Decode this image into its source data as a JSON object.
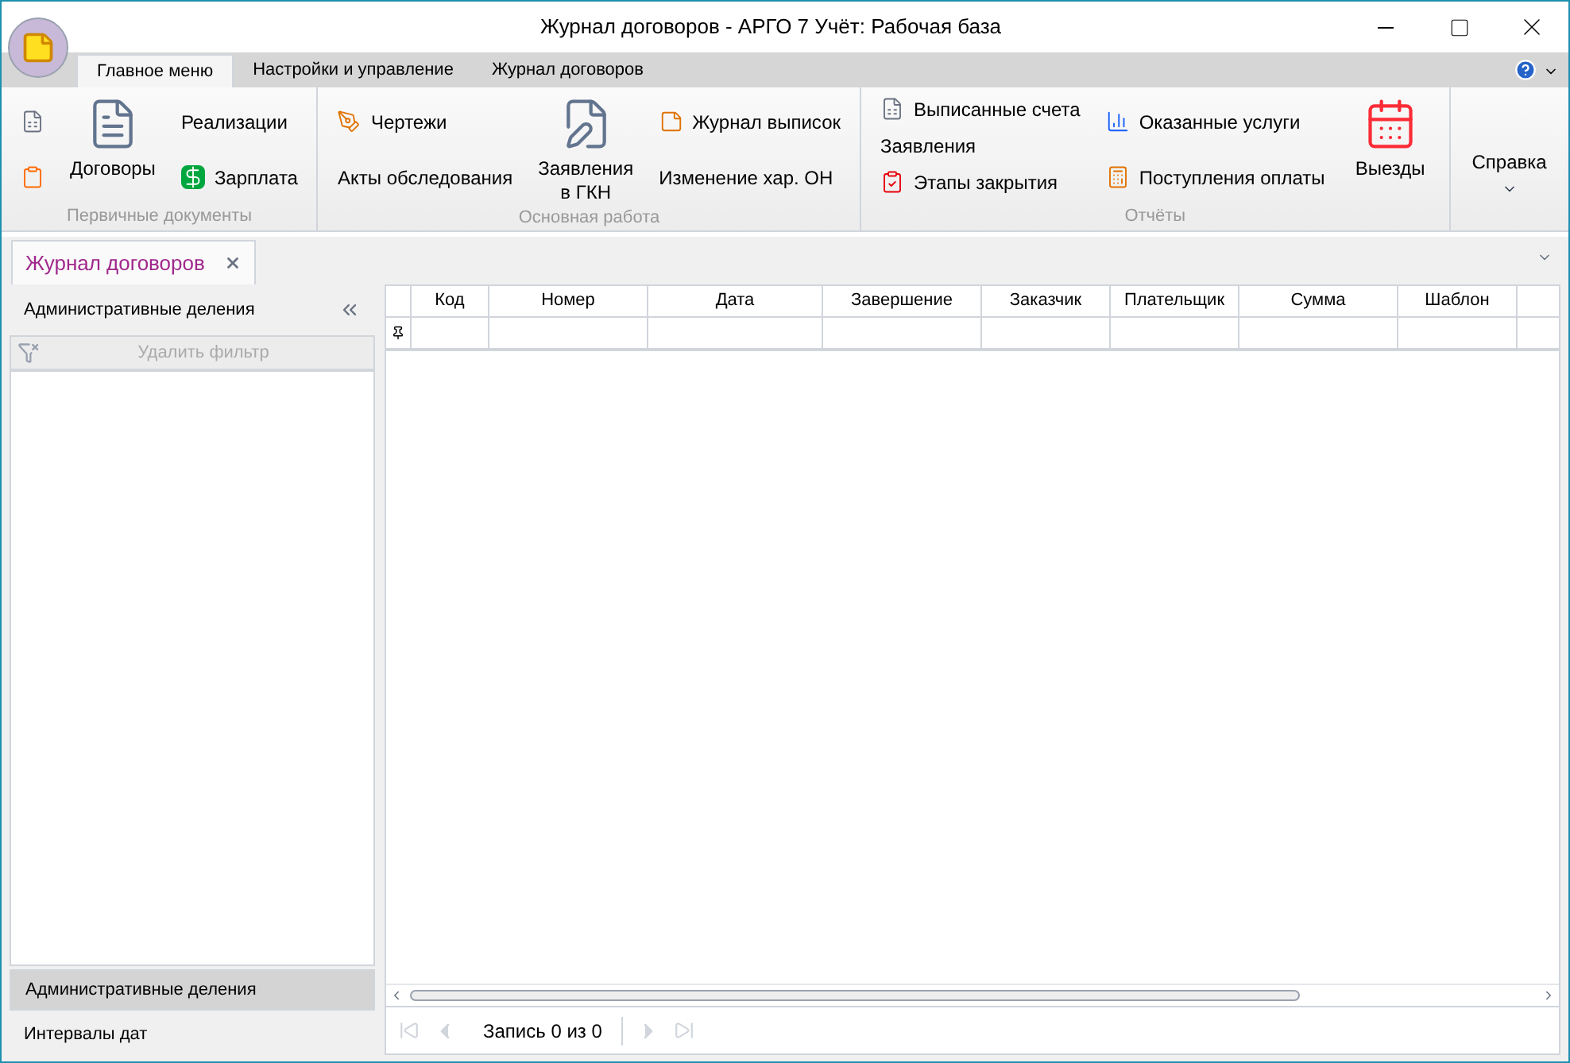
{
  "window": {
    "title": "Журнал договоров - АРГО 7 Учёт: Рабочая база"
  },
  "ribbon_tabs": [
    {
      "label": "Главное меню",
      "selected": true
    },
    {
      "label": "Настройки и управление",
      "selected": false
    },
    {
      "label": "Журнал договоров",
      "selected": false
    }
  ],
  "ribbon_groups": [
    {
      "label": "Первичные документы",
      "columns": [
        {
          "kind": "icons"
        },
        {
          "kind": "large",
          "items": [
            {
              "label": "Договоры"
            }
          ]
        },
        {
          "kind": "small",
          "items": [
            {
              "label": "Реализации"
            },
            {
              "label": "Зарплата"
            }
          ]
        }
      ]
    },
    {
      "label": "Основная работа",
      "columns": [
        {
          "kind": "small",
          "items": [
            {
              "label": "Чертежи"
            },
            {
              "label": "Акты обследования"
            }
          ]
        },
        {
          "kind": "large",
          "items": [
            {
              "label": "Заявления в ГКН"
            }
          ]
        },
        {
          "kind": "small",
          "items": [
            {
              "label": "Журнал выписок"
            },
            {
              "label": "Изменение хар. ОН"
            }
          ]
        }
      ]
    },
    {
      "label": "Отчёты",
      "columns": [
        {
          "kind": "small",
          "items": [
            {
              "label": "Выписанные счета"
            },
            {
              "label": "Заявления"
            },
            {
              "label": "Этапы закрытия"
            }
          ]
        },
        {
          "kind": "small",
          "items": [
            {
              "label": "Оказанные услуги"
            },
            {
              "label": "Поступления оплаты"
            }
          ]
        },
        {
          "kind": "large",
          "items": [
            {
              "label": "Выезды"
            }
          ]
        }
      ]
    },
    {
      "columns": [
        {
          "kind": "dropdown",
          "items": [
            {
              "label": "Справка"
            }
          ]
        }
      ]
    }
  ],
  "document_tab": {
    "label": "Журнал договоров"
  },
  "left_panel": {
    "title": "Административные деления",
    "remove_filter": {
      "label": "Удалить фильтр",
      "disabled": true
    },
    "sections": [
      {
        "label": "Административные деления",
        "selected": true
      },
      {
        "label": "Интервалы дат",
        "selected": false
      }
    ]
  },
  "table": {
    "columns": [
      "Код",
      "Номер",
      "Дата",
      "Завершение",
      "Заказчик",
      "Плательщик",
      "Сумма",
      "Шаблон"
    ]
  },
  "navigator": {
    "record_text": "Запись 0 из 0"
  }
}
